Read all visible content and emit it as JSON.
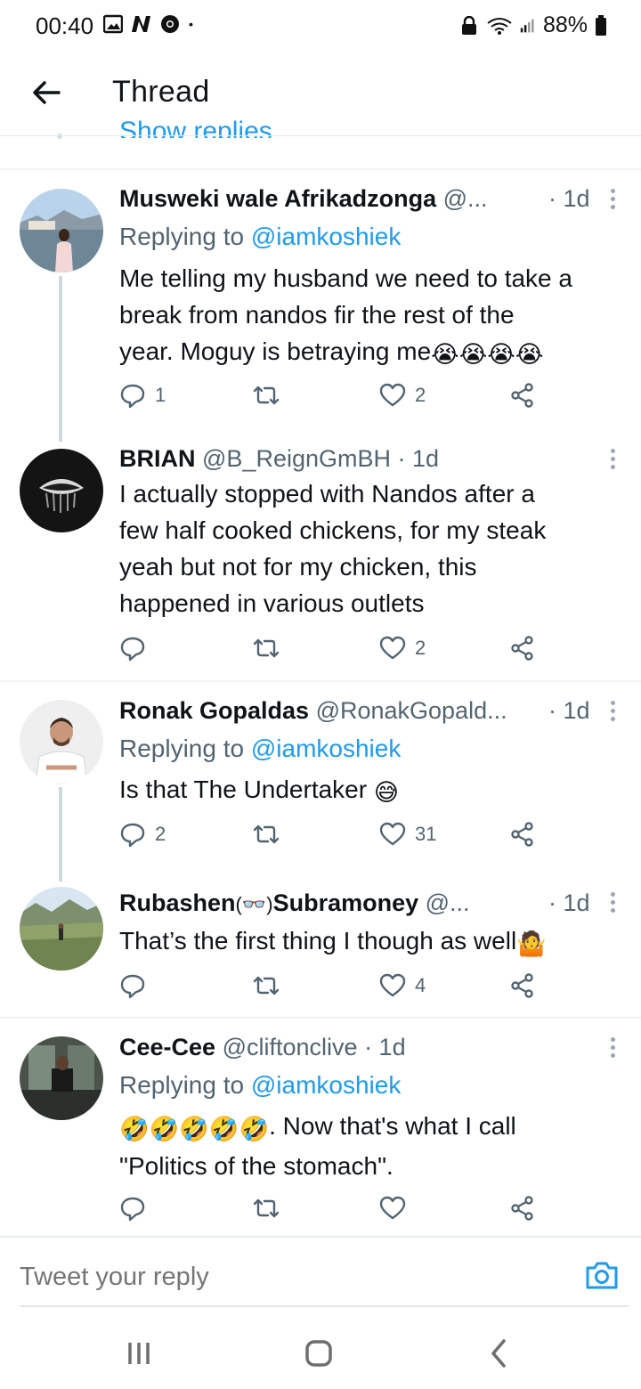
{
  "status_bar": {
    "time": "00:40",
    "battery": "88%"
  },
  "header": {
    "title": "Thread"
  },
  "show_replies": "Show replies",
  "tweets": [
    {
      "name": "Musweki wale Afrikadzonga",
      "handle": "@...",
      "time": "· 1d",
      "replying_prefix": "Replying to",
      "replying_to": "@iamkoshiek",
      "text_lines": [
        "Me telling my husband we need to take a",
        "break from nandos fir the rest of the",
        "year. Moguy is betraying me"
      ],
      "emoji_suffix": "😭😭😭😭",
      "reply_count": "1",
      "retweet_count": "",
      "like_count": "2"
    },
    {
      "name": "BRIAN",
      "handle": "@B_ReignGmBH",
      "time": "· 1d",
      "text_lines": [
        "I actually stopped with Nandos after a",
        "few half cooked chickens, for my steak",
        "yeah but not for my chicken, this",
        "happened in various outlets"
      ],
      "reply_count": "",
      "retweet_count": "",
      "like_count": "2"
    },
    {
      "name": "Ronak Gopaldas",
      "handle": "@RonakGopald...",
      "time": "· 1d",
      "replying_prefix": "Replying to",
      "replying_to": "@iamkoshiek",
      "text_lines": [
        "Is that The Undertaker"
      ],
      "emoji_suffix": "😅",
      "reply_count": "2",
      "retweet_count": "",
      "like_count": "31"
    },
    {
      "name": "Rubashen",
      "name_emoji": "(👓)",
      "name_rest": "Subramoney",
      "handle": "@...",
      "time": "· 1d",
      "text_lines": [
        "That’s the first thing I though as well"
      ],
      "emoji_suffix": "🤷",
      "reply_count": "",
      "retweet_count": "",
      "like_count": "4"
    },
    {
      "name": "Cee-Cee",
      "handle": "@cliftonclive",
      "time": "· 1d",
      "replying_prefix": "Replying to",
      "replying_to": "@iamkoshiek",
      "emoji_prefix": "🤣🤣🤣🤣🤣",
      "text_lines": [
        ". Now that's what I call",
        "\"Politics of the stomach\"."
      ],
      "reply_count": "",
      "retweet_count": "",
      "like_count": ""
    }
  ],
  "compose": {
    "placeholder": "Tweet your reply"
  },
  "colors": {
    "accent": "#1d9bf0",
    "secondary_text": "#536471",
    "primary_text": "#0f1419"
  },
  "icons": [
    "back-arrow-icon",
    "reply-icon",
    "retweet-icon",
    "like-icon",
    "share-icon",
    "more-icon",
    "camera-icon",
    "recents-icon",
    "home-icon",
    "back-nav-icon"
  ]
}
